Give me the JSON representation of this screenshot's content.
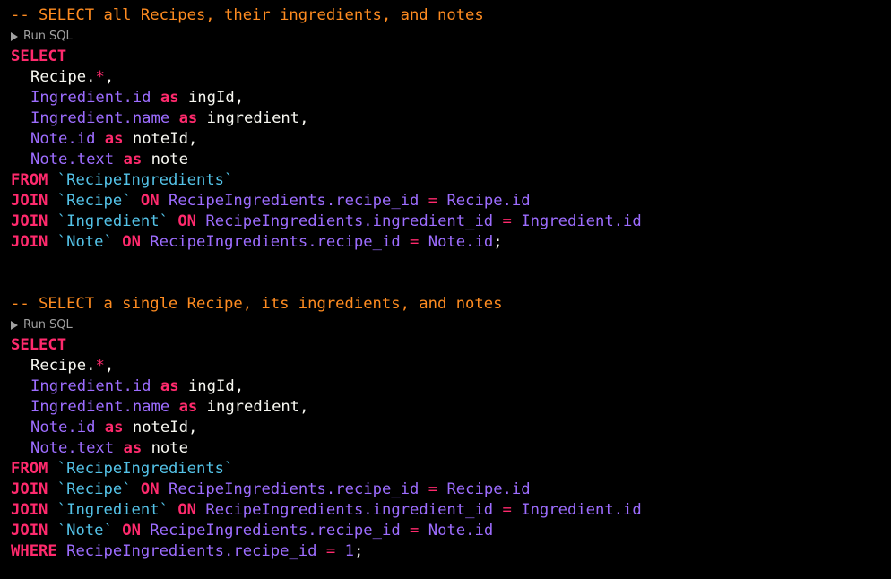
{
  "colors": {
    "background": "#000000",
    "keyword": "#ff2a6d",
    "identifier": "#9d6dff",
    "backtick_table": "#54c3e8",
    "plain": "#f8f8f2",
    "comment": "#ff8c21",
    "run_sql": "#a0a0a0"
  },
  "run_label": "Run SQL",
  "block1": {
    "comment": "-- SELECT all Recipes, their ingredients, and notes",
    "select": "SELECT",
    "recipe_star_a": "Recipe.",
    "star": "*",
    "comma": ",",
    "ing_id": "Ingredient.id",
    "as": "as",
    "ing_id_alias": "ingId,",
    "ing_name": "Ingredient.name",
    "ing_name_alias": "ingredient,",
    "note_id": "Note.id",
    "note_id_alias": "noteId,",
    "note_text": "Note.text",
    "note_text_alias": "note",
    "from": "FROM",
    "from_table": "`RecipeIngredients`",
    "join": "JOIN",
    "on": "ON",
    "eq": "=",
    "j1_table": "`Recipe`",
    "j1_left": "RecipeIngredients.recipe_id",
    "j1_right": "Recipe.id",
    "j2_table": "`Ingredient`",
    "j2_left": "RecipeIngredients.ingredient_id",
    "j2_right": "Ingredient.id",
    "j3_table": "`Note`",
    "j3_left": "RecipeIngredients.recipe_id",
    "j3_right": "Note.id",
    "semicolon": ";"
  },
  "block2": {
    "comment": "-- SELECT a single Recipe, its ingredients, and notes",
    "where": "WHERE",
    "where_left": "RecipeIngredients.recipe_id",
    "where_value": "1",
    "semicolon": ";"
  }
}
